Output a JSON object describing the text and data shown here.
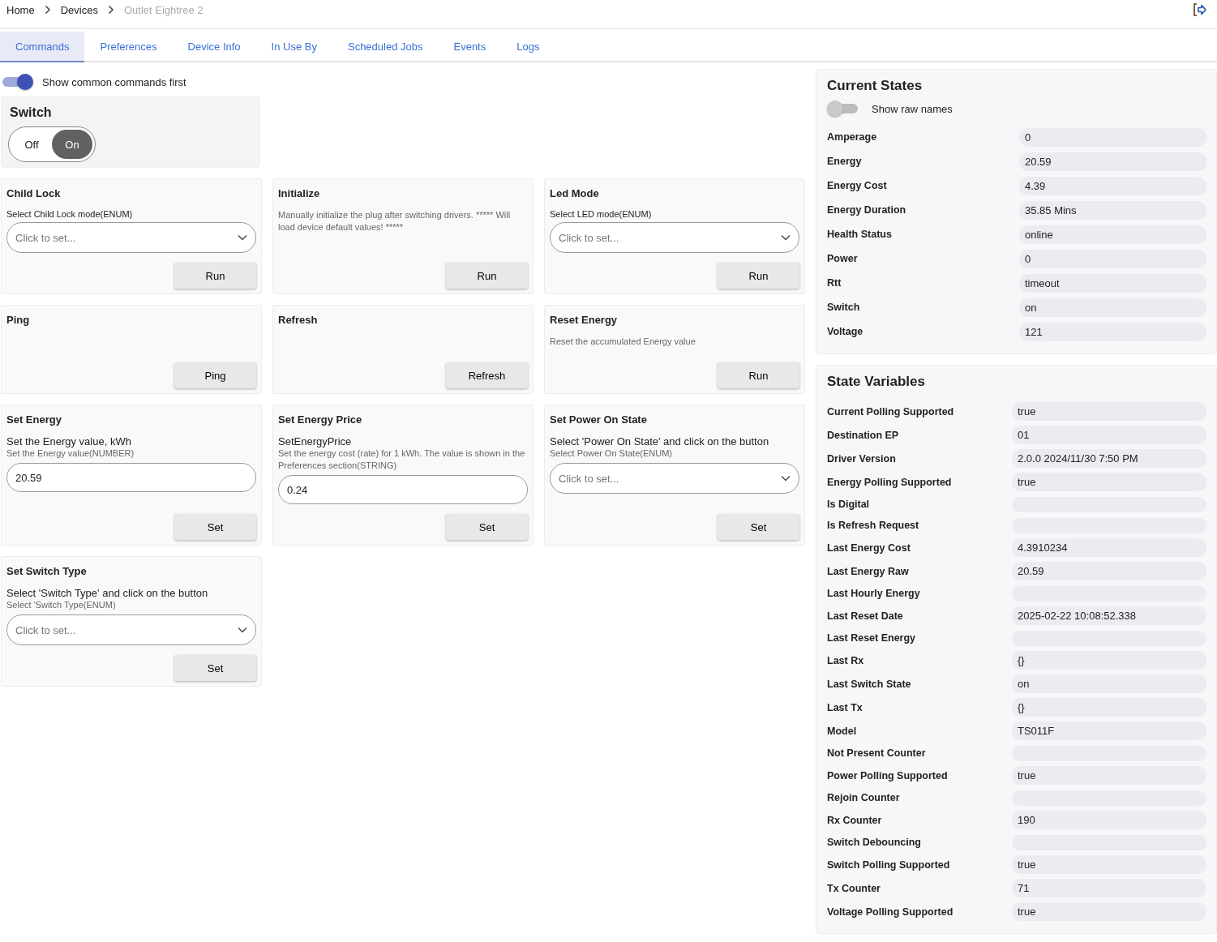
{
  "breadcrumbs": [
    {
      "label": "Home",
      "current": false
    },
    {
      "label": "Devices",
      "current": false
    },
    {
      "label": "Outlet Eightree 2",
      "current": true
    }
  ],
  "tabs": [
    {
      "label": "Commands",
      "selected": true
    },
    {
      "label": "Preferences",
      "selected": false
    },
    {
      "label": "Device Info",
      "selected": false
    },
    {
      "label": "In Use By",
      "selected": false
    },
    {
      "label": "Scheduled Jobs",
      "selected": false
    },
    {
      "label": "Events",
      "selected": false
    },
    {
      "label": "Logs",
      "selected": false
    }
  ],
  "common_toggle": {
    "label": "Show common commands first",
    "on": true
  },
  "switch_card": {
    "title": "Switch",
    "options": [
      {
        "label": "Off",
        "selected": false
      },
      {
        "label": "On",
        "selected": true
      }
    ]
  },
  "commands": [
    {
      "title": "Child Lock",
      "lines": [
        {
          "kind": "label",
          "text": "Select Child Lock mode(ENUM)"
        }
      ],
      "field": {
        "kind": "select",
        "placeholder": "Click to set..."
      },
      "button": "Run"
    },
    {
      "title": "Initialize",
      "lines": [
        {
          "kind": "note",
          "text": "Manually initialize the plug after switching drivers. ***** Will load device default values! *****"
        }
      ],
      "button": "Run"
    },
    {
      "title": "Led Mode",
      "lines": [
        {
          "kind": "label",
          "text": "Select LED mode(ENUM)"
        }
      ],
      "field": {
        "kind": "select",
        "placeholder": "Click to set..."
      },
      "button": "Run"
    },
    {
      "title": "Ping",
      "button": "Ping"
    },
    {
      "title": "Refresh",
      "button": "Refresh"
    },
    {
      "title": "Reset Energy",
      "lines": [
        {
          "kind": "note",
          "text": "Reset the accumulated Energy value"
        }
      ],
      "button": "Run"
    },
    {
      "title": "Set Energy",
      "lines": [
        {
          "kind": "prompt",
          "text": "Set the Energy value, kWh"
        },
        {
          "kind": "note",
          "text": "Set the Energy value(NUMBER)"
        }
      ],
      "field": {
        "kind": "input",
        "value": "20.59"
      },
      "button": "Set"
    },
    {
      "title": "Set Energy Price",
      "lines": [
        {
          "kind": "prompt",
          "text": "SetEnergyPrice"
        },
        {
          "kind": "note",
          "text": "Set the energy cost (rate) for 1 kWh. The value is shown in the Preferences section(STRING)"
        }
      ],
      "field": {
        "kind": "input",
        "value": "0.24"
      },
      "button": "Set"
    },
    {
      "title": "Set Power On State",
      "lines": [
        {
          "kind": "prompt",
          "text": "Select 'Power On State' and click on the button"
        },
        {
          "kind": "note",
          "text": "Select Power On State(ENUM)"
        }
      ],
      "field": {
        "kind": "select",
        "placeholder": "Click to set..."
      },
      "button": "Set"
    },
    {
      "title": "Set Switch Type",
      "lines": [
        {
          "kind": "prompt",
          "text": "Select 'Switch Type' and click on the button"
        },
        {
          "kind": "note",
          "text": "Select 'Switch Type(ENUM)"
        }
      ],
      "field": {
        "kind": "select",
        "placeholder": "Click to set..."
      },
      "button": "Set"
    }
  ],
  "current_states": {
    "title": "Current States",
    "raw_names_toggle": {
      "label": "Show raw names",
      "on": false
    },
    "rows": [
      {
        "name": "Amperage",
        "value": "0"
      },
      {
        "name": "Energy",
        "value": "20.59"
      },
      {
        "name": "Energy Cost",
        "value": "4.39"
      },
      {
        "name": "Energy Duration",
        "value": "35.85 Mins"
      },
      {
        "name": "Health Status",
        "value": "online"
      },
      {
        "name": "Power",
        "value": "0"
      },
      {
        "name": "Rtt",
        "value": "timeout"
      },
      {
        "name": "Switch",
        "value": "on"
      },
      {
        "name": "Voltage",
        "value": "121"
      }
    ]
  },
  "state_variables": {
    "title": "State Variables",
    "rows": [
      {
        "name": "Current Polling Supported",
        "value": "true"
      },
      {
        "name": "Destination EP",
        "value": "01"
      },
      {
        "name": "Driver Version",
        "value": "2.0.0 2024/11/30 7:50 PM"
      },
      {
        "name": "Energy Polling Supported",
        "value": "true"
      },
      {
        "name": "Is Digital"
      },
      {
        "name": "Is Refresh Request"
      },
      {
        "name": "Last Energy Cost",
        "value": "4.3910234"
      },
      {
        "name": "Last Energy Raw",
        "value": "20.59"
      },
      {
        "name": "Last Hourly Energy"
      },
      {
        "name": "Last Reset Date",
        "value": "2025-02-22 10:08:52.338"
      },
      {
        "name": "Last Reset Energy"
      },
      {
        "name": "Last Rx",
        "value": "{}"
      },
      {
        "name": "Last Switch State",
        "value": "on"
      },
      {
        "name": "Last Tx",
        "value": "{}"
      },
      {
        "name": "Model",
        "value": "TS011F"
      },
      {
        "name": "Not Present Counter"
      },
      {
        "name": "Power Polling Supported",
        "value": "true"
      },
      {
        "name": "Rejoin Counter"
      },
      {
        "name": "Rx Counter",
        "value": "190"
      },
      {
        "name": "Switch Debouncing"
      },
      {
        "name": "Switch Polling Supported",
        "value": "true"
      },
      {
        "name": "Tx Counter",
        "value": "71"
      },
      {
        "name": "Voltage Polling Supported",
        "value": "true"
      }
    ]
  }
}
